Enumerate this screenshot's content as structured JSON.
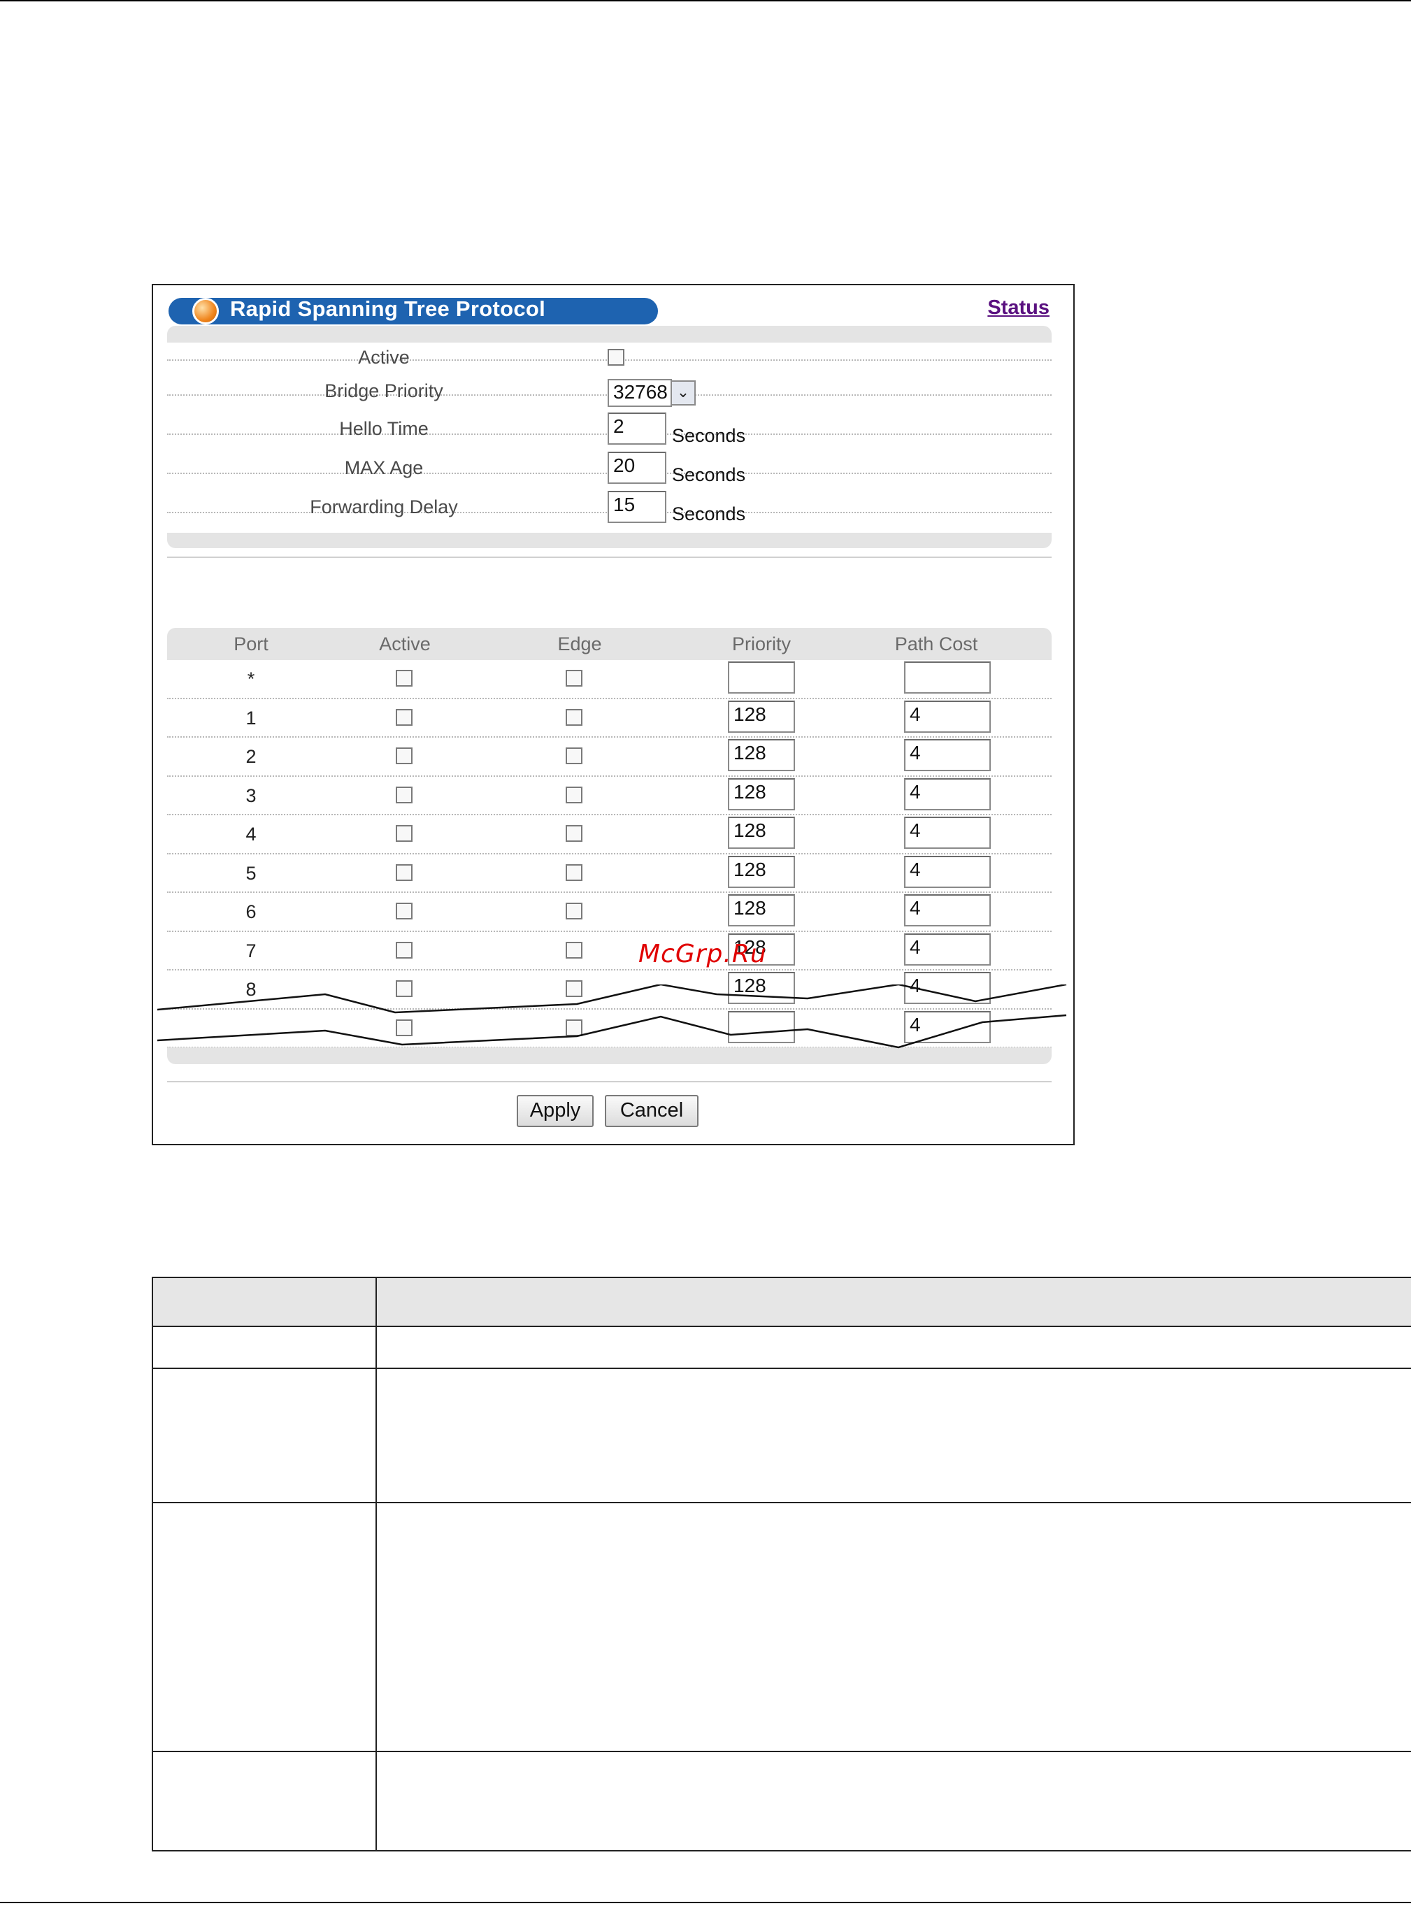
{
  "panel": {
    "title": "Rapid Spanning Tree Protocol",
    "status_link": "Status"
  },
  "general": [
    {
      "label": "Active",
      "type": "checkbox",
      "checked": false
    },
    {
      "label": "Bridge Priority",
      "type": "select",
      "value": "32768"
    },
    {
      "label": "Hello Time",
      "type": "text",
      "value": "2",
      "unit": "Seconds"
    },
    {
      "label": "MAX Age",
      "type": "text",
      "value": "20",
      "unit": "Seconds"
    },
    {
      "label": "Forwarding Delay",
      "type": "text",
      "value": "15",
      "unit": "Seconds"
    }
  ],
  "ports": {
    "headers": [
      "Port",
      "Active",
      "Edge",
      "Priority",
      "Path Cost"
    ],
    "rows": [
      {
        "port": "*",
        "active": false,
        "edge": false,
        "priority": "",
        "path_cost": ""
      },
      {
        "port": "1",
        "active": false,
        "edge": false,
        "priority": "128",
        "path_cost": "4"
      },
      {
        "port": "2",
        "active": false,
        "edge": false,
        "priority": "128",
        "path_cost": "4"
      },
      {
        "port": "3",
        "active": false,
        "edge": false,
        "priority": "128",
        "path_cost": "4"
      },
      {
        "port": "4",
        "active": false,
        "edge": false,
        "priority": "128",
        "path_cost": "4"
      },
      {
        "port": "5",
        "active": false,
        "edge": false,
        "priority": "128",
        "path_cost": "4"
      },
      {
        "port": "6",
        "active": false,
        "edge": false,
        "priority": "128",
        "path_cost": "4"
      },
      {
        "port": "7",
        "active": false,
        "edge": false,
        "priority": "128",
        "path_cost": "4"
      },
      {
        "port": "8",
        "active": false,
        "edge": false,
        "priority": "128",
        "path_cost": "4"
      },
      {
        "port": "",
        "active": false,
        "edge": false,
        "priority": "",
        "path_cost": "4"
      }
    ]
  },
  "buttons": {
    "apply": "Apply",
    "cancel": "Cancel"
  },
  "watermark": "McGrp.Ru"
}
